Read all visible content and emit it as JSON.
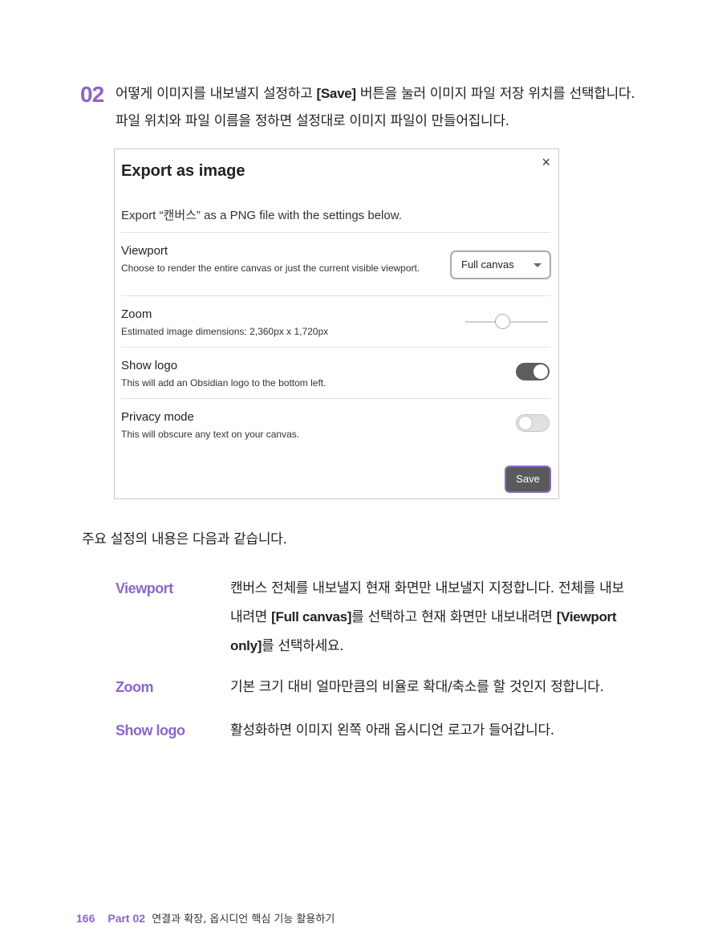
{
  "step": {
    "number": "02",
    "text_before": "어떻게 이미지를 내보낼지 설정하고 ",
    "keyword": "[Save]",
    "text_after": " 버튼을 눌러 이미지 파일 저장 위치를 선택합니다. 파일 위치와 파일 이름을 정하면 설정대로 이미지 파일이 만들어집니다."
  },
  "dialog": {
    "close_icon": "×",
    "title": "Export as image",
    "description": "Export “캔버스” as a PNG file with the settings below.",
    "viewport": {
      "name": "Viewport",
      "desc": "Choose to render the entire canvas or just the current visible viewport.",
      "selected": "Full canvas"
    },
    "zoom": {
      "name": "Zoom",
      "desc": "Estimated image dimensions: 2,360px x 1,720px",
      "level": 0.45
    },
    "show_logo": {
      "name": "Show logo",
      "desc": "This will add an Obsidian logo to the bottom left.",
      "on": true
    },
    "privacy_mode": {
      "name": "Privacy mode",
      "desc": "This will obscure any text on your canvas.",
      "on": false
    },
    "save_label": "Save"
  },
  "intro": "주요 설정의 내용은 다음과 같습니다.",
  "definitions": {
    "viewport": {
      "term": "Viewport",
      "t1": "캔버스 전체를 내보낼지 현재 화면만 내보낼지 지정합니다. 전체를 내보내려면 ",
      "k1": "[Full canvas]",
      "t2": "를 선택하고 현재 화면만 내보내려면 ",
      "k2": "[Viewport only]",
      "t3": "를 선택하세요."
    },
    "zoom": {
      "term": "Zoom",
      "body": "기본 크기 대비 얼마만큼의 비율로 확대/축소를 할 것인지 정합니다."
    },
    "show_logo": {
      "term": "Show logo",
      "body": "활성화하면 이미지 왼쪽 아래 옵시디언 로고가 들어갑니다."
    }
  },
  "footer": {
    "page_number": "166",
    "part": "Part 02",
    "chapter": "연결과 확장, 옵시디언 핵심 기능 활용하기"
  }
}
